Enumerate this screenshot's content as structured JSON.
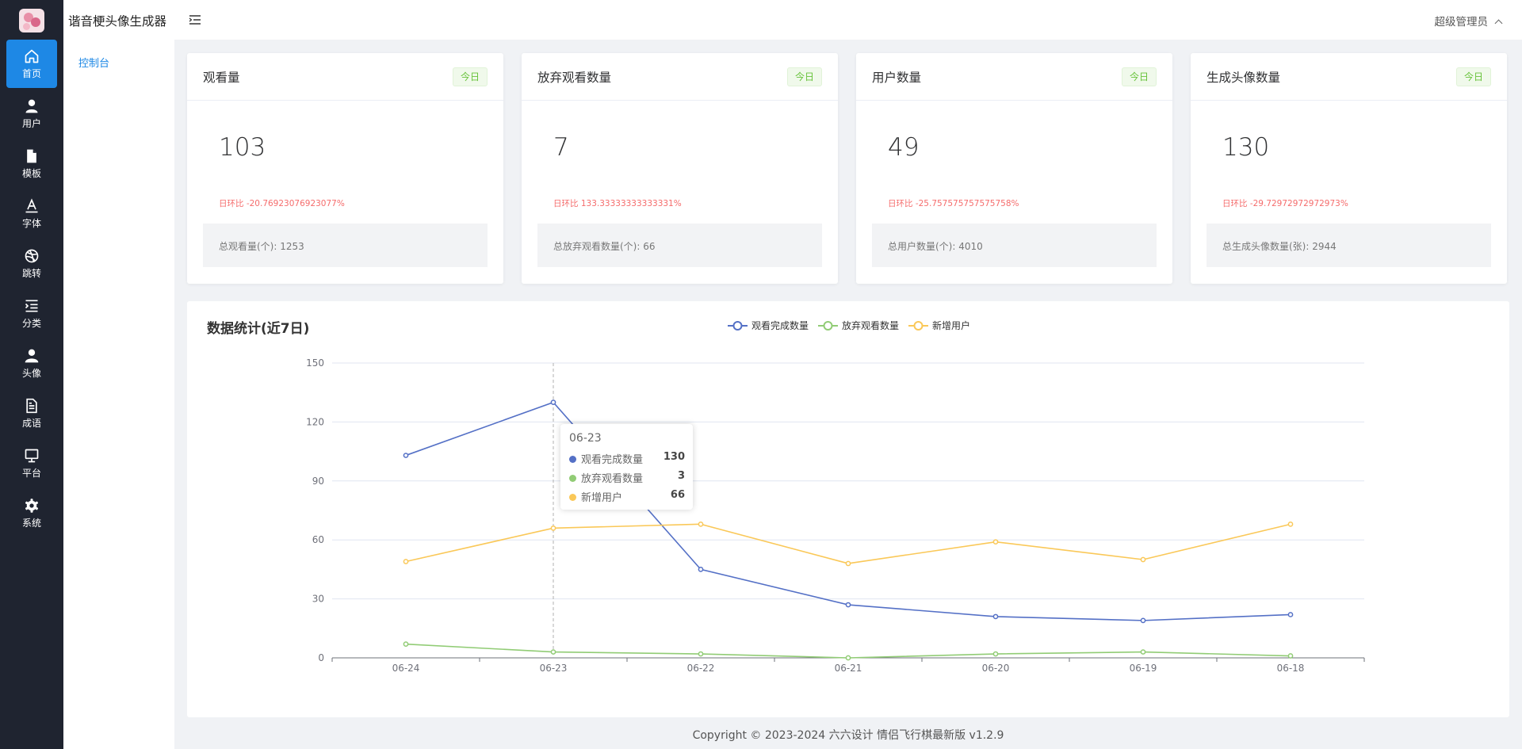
{
  "app": {
    "title": "谐音梗头像生成器"
  },
  "rail": {
    "items": [
      {
        "label": "首页",
        "icon": "home-icon"
      },
      {
        "label": "用户",
        "icon": "user-icon"
      },
      {
        "label": "模板",
        "icon": "document-icon"
      },
      {
        "label": "字体",
        "icon": "font-icon"
      },
      {
        "label": "跳转",
        "icon": "dribbble-icon"
      },
      {
        "label": "分类",
        "icon": "indent-list-icon"
      },
      {
        "label": "头像",
        "icon": "avatar-icon"
      },
      {
        "label": "成语",
        "icon": "notes-icon"
      },
      {
        "label": "平台",
        "icon": "monitor-icon"
      },
      {
        "label": "系统",
        "icon": "gear-icon"
      }
    ]
  },
  "sidebar": {
    "items": [
      {
        "label": "控制台"
      }
    ]
  },
  "header": {
    "user": "超级管理员"
  },
  "cards": [
    {
      "title": "观看量",
      "tag": "今日",
      "value": "103",
      "ratio": "日环比 -20.76923076923077%",
      "total": "总观看量(个): 1253"
    },
    {
      "title": "放弃观看数量",
      "tag": "今日",
      "value": "7",
      "ratio": "日环比 133.33333333333331%",
      "total": "总放弃观看数量(个): 66"
    },
    {
      "title": "用户数量",
      "tag": "今日",
      "value": "49",
      "ratio": "日环比 -25.757575757575758%",
      "total": "总用户数量(个): 4010"
    },
    {
      "title": "生成头像数量",
      "tag": "今日",
      "value": "130",
      "ratio": "日环比 -29.72972972972973%",
      "total": "总生成头像数量(张): 2944"
    }
  ],
  "panel": {
    "title": "数据统计(近7日)"
  },
  "colors": {
    "blue": "#5470c6",
    "green": "#91cc75",
    "yellow": "#fac858",
    "accent": "#1e88e5",
    "rail": "#1f2430"
  },
  "chart_data": {
    "type": "line",
    "title": "数据统计(近7日)",
    "categories": [
      "06-24",
      "06-23",
      "06-22",
      "06-21",
      "06-20",
      "06-19",
      "06-18"
    ],
    "ylim": [
      0,
      150
    ],
    "yticks": [
      0,
      30,
      60,
      90,
      120,
      150
    ],
    "grid": true,
    "legend": "top-center",
    "series": [
      {
        "name": "观看完成数量",
        "color": "#5470c6",
        "values": [
          103,
          130,
          45,
          27,
          21,
          19,
          22
        ]
      },
      {
        "name": "放弃观看数量",
        "color": "#91cc75",
        "values": [
          7,
          3,
          2,
          0,
          2,
          3,
          1
        ]
      },
      {
        "name": "新增用户",
        "color": "#fac858",
        "values": [
          49,
          66,
          68,
          48,
          59,
          50,
          68
        ]
      }
    ]
  },
  "tooltip": {
    "date": "06-23",
    "rows": [
      {
        "name": "观看完成数量",
        "value": "130"
      },
      {
        "name": "放弃观看数量",
        "value": "3"
      },
      {
        "name": "新增用户",
        "value": "66"
      }
    ]
  },
  "footer": "Copyright © 2023-2024 六六设计  情侣飞行棋最新版 v1.2.9"
}
